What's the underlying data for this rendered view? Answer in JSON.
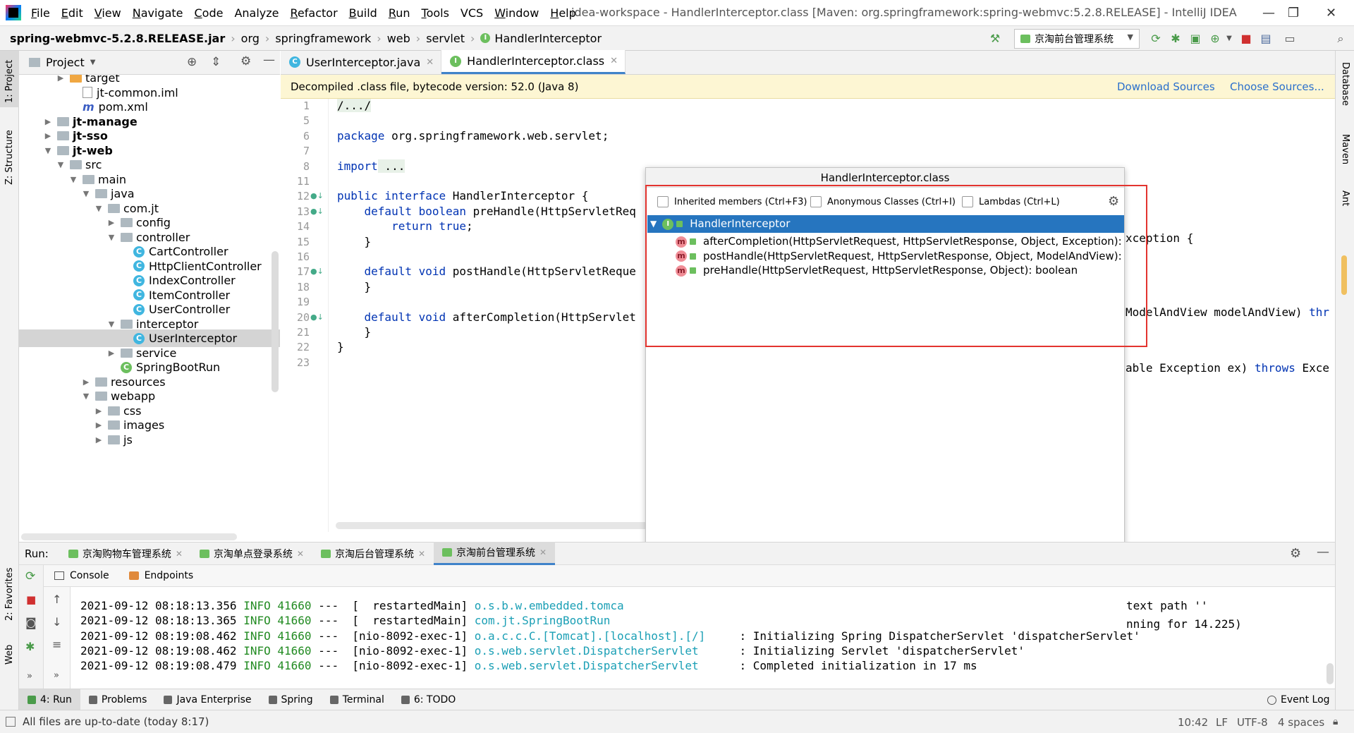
{
  "menu": {
    "items": [
      {
        "label": "File",
        "u": "F",
        "rest": "ile"
      },
      {
        "label": "Edit",
        "u": "E",
        "rest": "dit"
      },
      {
        "label": "View",
        "u": "V",
        "rest": "iew"
      },
      {
        "label": "Navigate",
        "u": "N",
        "rest": "avigate"
      },
      {
        "label": "Code",
        "u": "C",
        "rest": "ode"
      },
      {
        "label": "Analyze",
        "u": "",
        "rest": "Analyze"
      },
      {
        "label": "Refactor",
        "u": "R",
        "rest": "efactor"
      },
      {
        "label": "Build",
        "u": "B",
        "rest": "uild"
      },
      {
        "label": "Run",
        "u": "R",
        "rest": "un"
      },
      {
        "label": "Tools",
        "u": "T",
        "rest": "ools"
      },
      {
        "label": "VCS",
        "u": "",
        "rest": "VCS"
      },
      {
        "label": "Window",
        "u": "W",
        "rest": "indow"
      },
      {
        "label": "Help",
        "u": "H",
        "rest": "elp"
      }
    ],
    "window_title": "idea-workspace - HandlerInterceptor.class [Maven: org.springframework:spring-webmvc:5.2.8.RELEASE] - IntelliJ IDEA"
  },
  "breadcrumb": [
    "spring-webmvc-5.2.8.RELEASE.jar",
    "org",
    "springframework",
    "web",
    "servlet",
    "HandlerInterceptor"
  ],
  "run_config": "京淘前台管理系统",
  "left_strip": {
    "project": "1: Project",
    "structure": "Z: Structure",
    "favorites": "2: Favorites",
    "web": "Web"
  },
  "right_strip": {
    "database": "Database",
    "maven": "Maven",
    "ant": "Ant"
  },
  "project_panel": {
    "title": "Project",
    "tree": [
      {
        "label": "target",
        "depth": 3,
        "arrow": "▶",
        "icon": "folder-orange"
      },
      {
        "label": "jt-common.iml",
        "depth": 4,
        "arrow": "",
        "icon": "file"
      },
      {
        "label": "pom.xml",
        "depth": 4,
        "arrow": "",
        "icon": "maven"
      },
      {
        "label": "jt-manage",
        "depth": 2,
        "arrow": "▶",
        "icon": "folder",
        "bold": true
      },
      {
        "label": "jt-sso",
        "depth": 2,
        "arrow": "▶",
        "icon": "folder",
        "bold": true
      },
      {
        "label": "jt-web",
        "depth": 2,
        "arrow": "▼",
        "icon": "folder",
        "bold": true
      },
      {
        "label": "src",
        "depth": 3,
        "arrow": "▼",
        "icon": "folder"
      },
      {
        "label": "main",
        "depth": 4,
        "arrow": "▼",
        "icon": "folder"
      },
      {
        "label": "java",
        "depth": 5,
        "arrow": "▼",
        "icon": "folder"
      },
      {
        "label": "com.jt",
        "depth": 6,
        "arrow": "▼",
        "icon": "folder"
      },
      {
        "label": "config",
        "depth": 7,
        "arrow": "▶",
        "icon": "folder"
      },
      {
        "label": "controller",
        "depth": 7,
        "arrow": "▼",
        "icon": "folder"
      },
      {
        "label": "CartController",
        "depth": 8,
        "arrow": "",
        "icon": "class"
      },
      {
        "label": "HttpClientController",
        "depth": 8,
        "arrow": "",
        "icon": "class"
      },
      {
        "label": "IndexController",
        "depth": 8,
        "arrow": "",
        "icon": "class"
      },
      {
        "label": "ItemController",
        "depth": 8,
        "arrow": "",
        "icon": "class"
      },
      {
        "label": "UserController",
        "depth": 8,
        "arrow": "",
        "icon": "class"
      },
      {
        "label": "interceptor",
        "depth": 7,
        "arrow": "▼",
        "icon": "folder"
      },
      {
        "label": "UserInterceptor",
        "depth": 8,
        "arrow": "",
        "icon": "class",
        "selected": true
      },
      {
        "label": "service",
        "depth": 7,
        "arrow": "▶",
        "icon": "folder"
      },
      {
        "label": "SpringBootRun",
        "depth": 7,
        "arrow": "",
        "icon": "boot"
      },
      {
        "label": "resources",
        "depth": 5,
        "arrow": "▶",
        "icon": "folder"
      },
      {
        "label": "webapp",
        "depth": 5,
        "arrow": "▼",
        "icon": "folder"
      },
      {
        "label": "css",
        "depth": 6,
        "arrow": "▶",
        "icon": "folder"
      },
      {
        "label": "images",
        "depth": 6,
        "arrow": "▶",
        "icon": "folder"
      },
      {
        "label": "js",
        "depth": 6,
        "arrow": "▶",
        "icon": "folder"
      }
    ]
  },
  "editor": {
    "tabs": [
      {
        "label": "UserInterceptor.java",
        "icon": "C",
        "color": "#40b6e0",
        "active": false
      },
      {
        "label": "HandlerInterceptor.class",
        "icon": "I",
        "color": "#6cbf5e",
        "active": true
      }
    ],
    "banner": "Decompiled .class file, bytecode version: 52.0 (Java 8)",
    "download_sources": "Download Sources",
    "choose_sources": "Choose Sources...",
    "line_numbers": [
      "1",
      "5",
      "6",
      "7",
      "8",
      "11",
      "12",
      "13",
      "14",
      "15",
      "16",
      "17",
      "18",
      "19",
      "20",
      "21",
      "22",
      "23"
    ],
    "code_lines": [
      [
        {
          "t": "/.../",
          "c": "fold"
        }
      ],
      [],
      [
        {
          "t": "package",
          "c": "kw"
        },
        {
          "t": " org.springframework.web.servlet;",
          "c": ""
        }
      ],
      [],
      [
        {
          "t": "import",
          "c": "kw"
        },
        {
          "t": " ...",
          "c": "fold"
        }
      ],
      [],
      [
        {
          "t": "public interface",
          "c": "kw"
        },
        {
          "t": " HandlerInterceptor {",
          "c": ""
        }
      ],
      [
        {
          "t": "    default boolean",
          "c": "kw"
        },
        {
          "t": " preHandle(HttpServletReq",
          "c": ""
        }
      ],
      [
        {
          "t": "        return true",
          "c": "kw"
        },
        {
          "t": ";",
          "c": ""
        }
      ],
      [
        {
          "t": "    }",
          "c": ""
        }
      ],
      [],
      [
        {
          "t": "    default void",
          "c": "kw"
        },
        {
          "t": " postHandle(HttpServletReque",
          "c": ""
        }
      ],
      [
        {
          "t": "    }",
          "c": ""
        }
      ],
      [],
      [
        {
          "t": "    default void",
          "c": "kw"
        },
        {
          "t": " afterCompletion(HttpServlet",
          "c": ""
        }
      ],
      [
        {
          "t": "    }",
          "c": ""
        }
      ],
      [
        {
          "t": "}",
          "c": ""
        }
      ],
      []
    ],
    "right_fragments": {
      "line13": "xception {",
      "line17a": "ModelAndView modelAndView) ",
      "line17b": "thr",
      "line20a": "able Exception ex) ",
      "line20b": "throws",
      "line20c": " Exce"
    }
  },
  "structure_popup": {
    "title": "HandlerInterceptor.class",
    "inherited": "Inherited members (Ctrl+F3)",
    "anonymous": "Anonymous Classes (Ctrl+I)",
    "lambdas": "Lambdas (Ctrl+L)",
    "root": "HandlerInterceptor",
    "members": [
      "afterCompletion(HttpServletRequest, HttpServletResponse, Object, Exception):",
      "postHandle(HttpServletRequest, HttpServletResponse, Object, ModelAndView):",
      "preHandle(HttpServletRequest, HttpServletResponse, Object): boolean"
    ],
    "highlight_color": "#e3342f"
  },
  "run_panel": {
    "label": "Run:",
    "tabs": [
      {
        "label": "京淘购物车管理系统",
        "active": false
      },
      {
        "label": "京淘单点登录系统",
        "active": false
      },
      {
        "label": "京淘后台管理系统",
        "active": false
      },
      {
        "label": "京淘前台管理系统",
        "active": true
      }
    ],
    "subtabs": [
      "Console",
      "Endpoints"
    ],
    "logs": [
      {
        "date": "2021-09-12 08:18:13.356",
        "level": "INFO",
        "pid": "41660",
        "thread": "---  [  restartedMain]",
        "logger": "o.s.b.w.embedded.tomca",
        "msg": ""
      },
      {
        "date": "2021-09-12 08:18:13.365",
        "level": "INFO",
        "pid": "41660",
        "thread": "---  [  restartedMain]",
        "logger": "com.jt.SpringBootRun",
        "msg": ""
      },
      {
        "date": "2021-09-12 08:19:08.462",
        "level": "INFO",
        "pid": "41660",
        "thread": "---  [nio-8092-exec-1]",
        "logger": "o.a.c.c.C.[Tomcat].[localhost].[/]",
        "msg": "    : Initializing Spring DispatcherServlet 'dispatcherServlet'"
      },
      {
        "date": "2021-09-12 08:19:08.462",
        "level": "INFO",
        "pid": "41660",
        "thread": "---  [nio-8092-exec-1]",
        "logger": "o.s.web.servlet.DispatcherServlet",
        "msg": "     : Initializing Servlet 'dispatcherServlet'"
      },
      {
        "date": "2021-09-12 08:19:08.479",
        "level": "INFO",
        "pid": "41660",
        "thread": "---  [nio-8092-exec-1]",
        "logger": "o.s.web.servlet.DispatcherServlet",
        "msg": "     : Completed initialization in 17 ms"
      }
    ],
    "right_fragments": [
      "text path ''",
      "nning for 14.225)"
    ]
  },
  "bottom_tabs": [
    {
      "label": "4: Run",
      "active": true
    },
    {
      "label": "Problems",
      "active": false
    },
    {
      "label": "Java Enterprise",
      "active": false
    },
    {
      "label": "Spring",
      "active": false
    },
    {
      "label": "Terminal",
      "active": false
    },
    {
      "label": "6: TODO",
      "active": false
    }
  ],
  "event_log": "Event Log",
  "status": {
    "message": "All files are up-to-date (today 8:17)",
    "position": "10:42",
    "line_sep": "LF",
    "encoding": "UTF-8",
    "indent": "4 spaces"
  }
}
